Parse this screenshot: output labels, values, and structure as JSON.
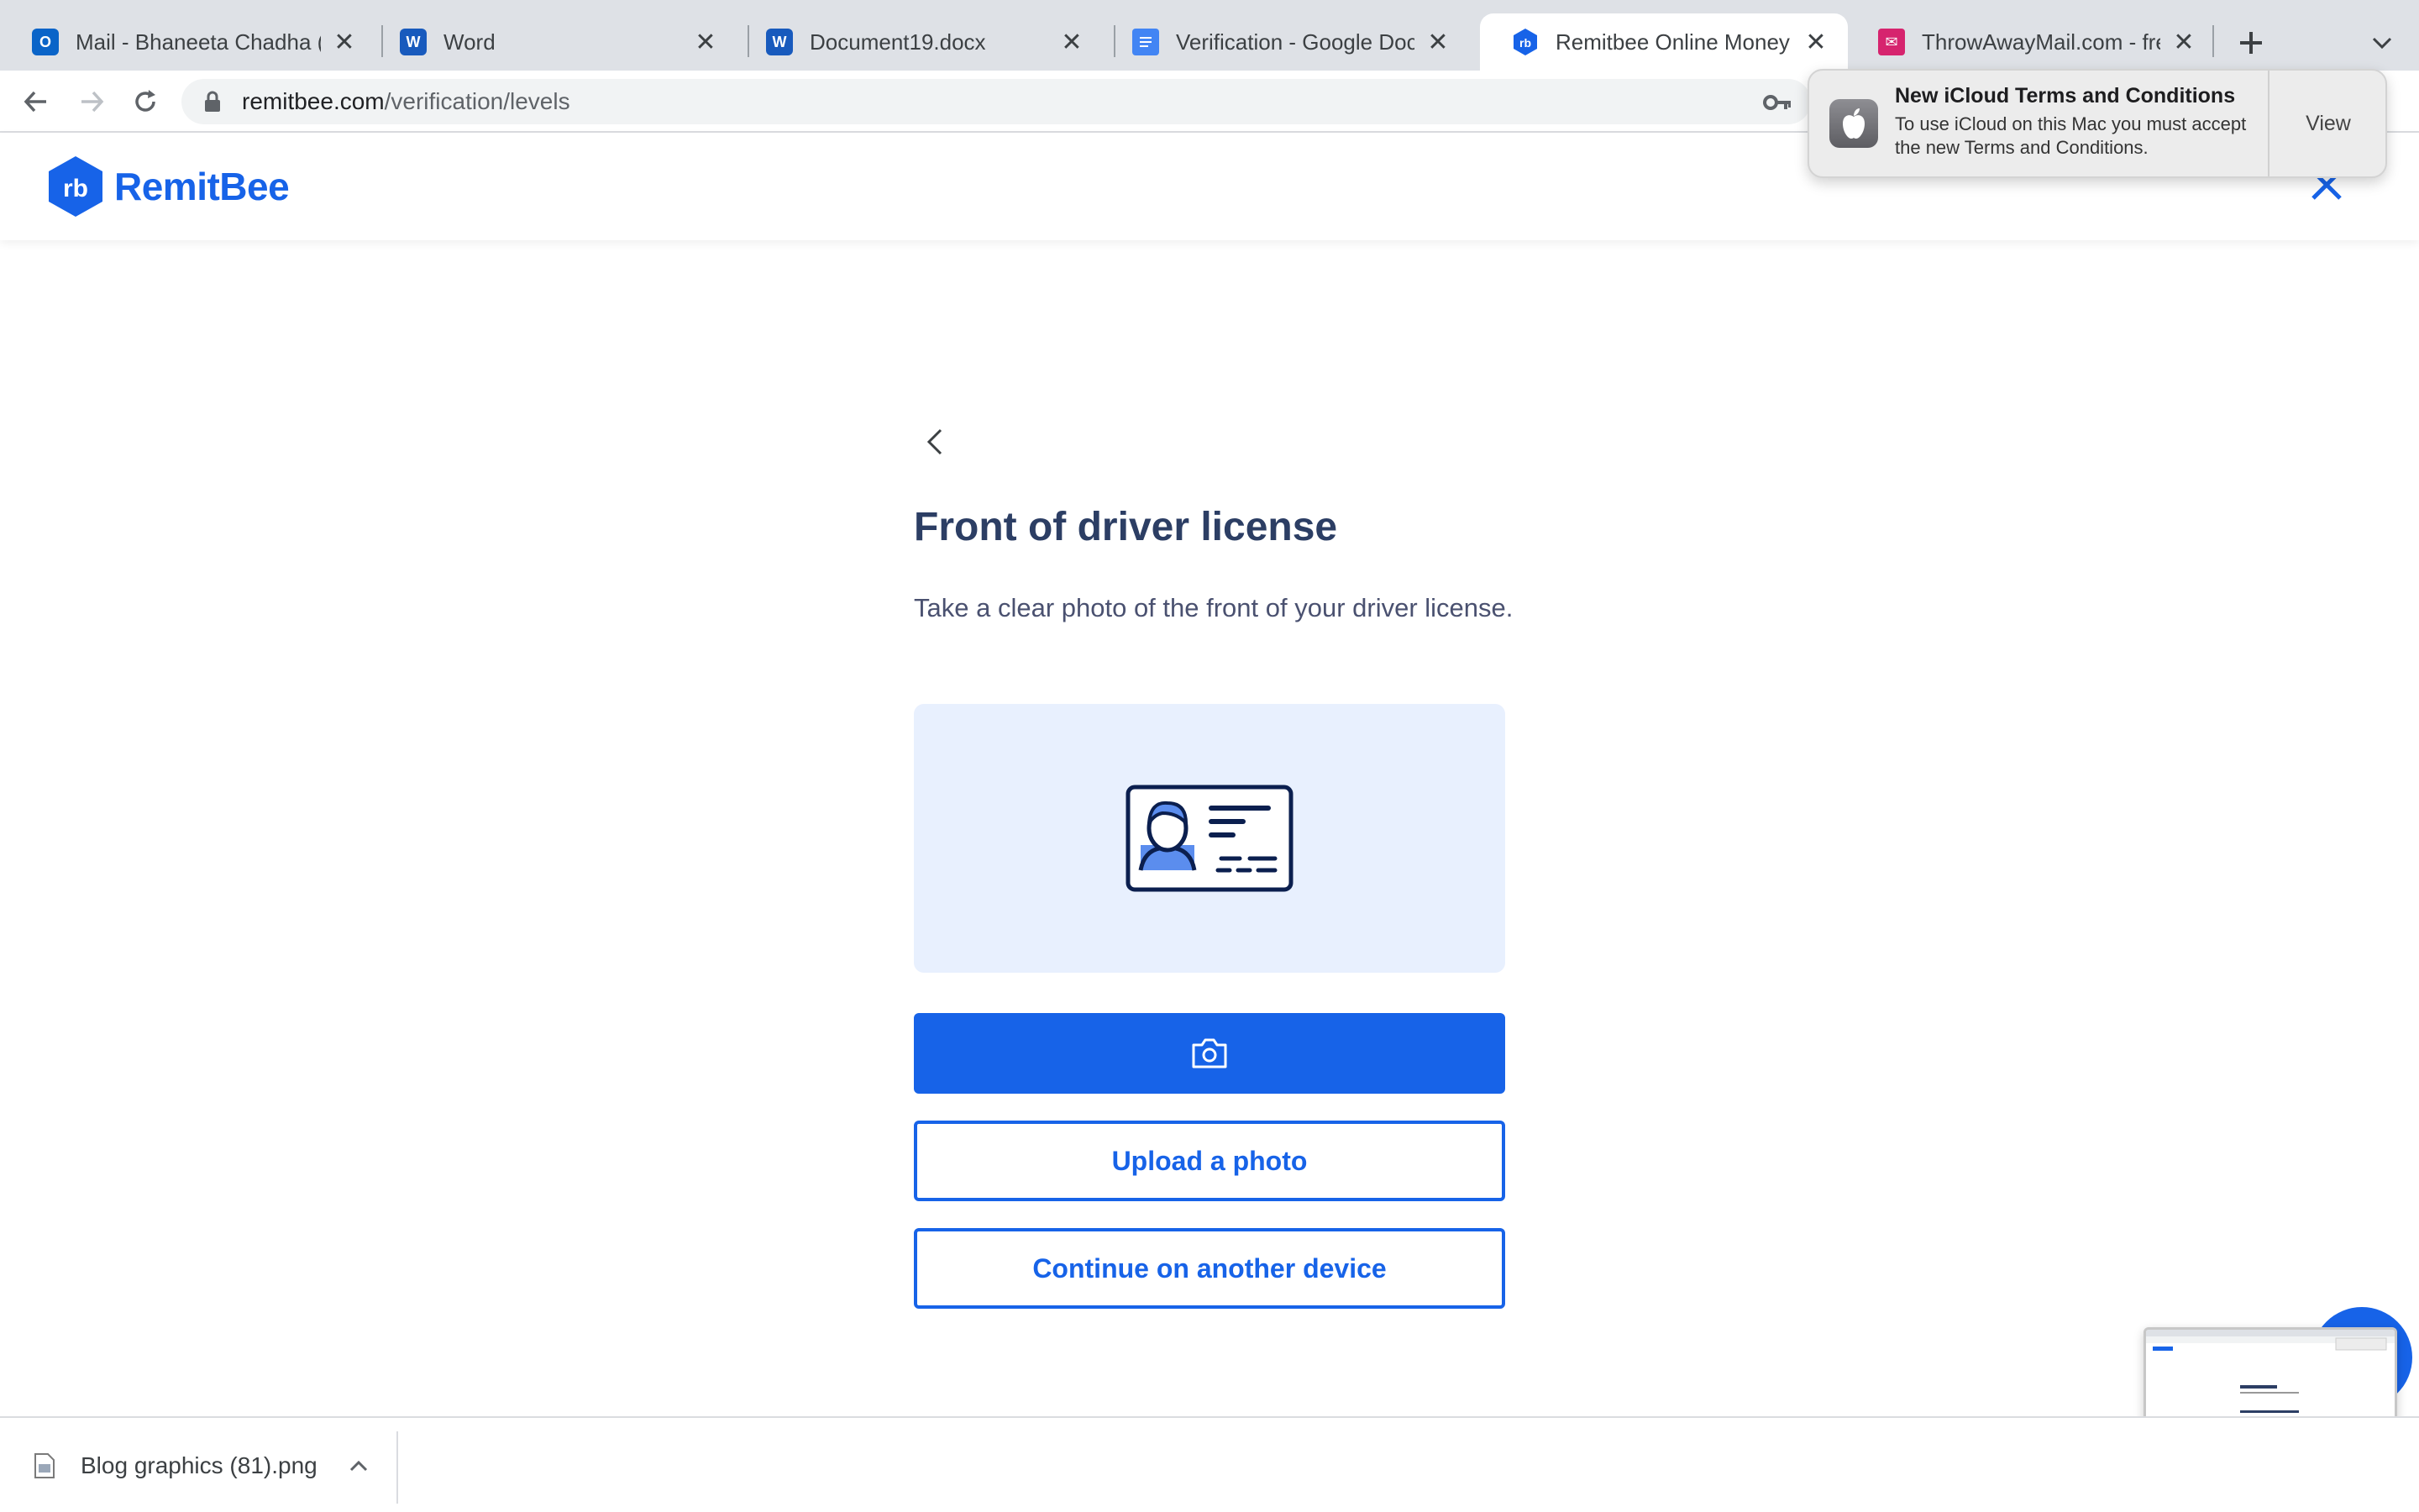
{
  "browser": {
    "tabs": [
      {
        "title": "Mail - Bhaneeta Chadha (Re",
        "favicon": "outlook-icon",
        "color": "#0a64c8"
      },
      {
        "title": "Word",
        "favicon": "word-icon",
        "color": "#185abd"
      },
      {
        "title": "Document19.docx",
        "favicon": "word-icon",
        "color": "#185abd"
      },
      {
        "title": "Verification - Google Docs",
        "favicon": "google-docs-icon",
        "color": "#4285f4"
      },
      {
        "title": "Remitbee Online Money Tra",
        "favicon": "remitbee-icon",
        "color": "#1763e8"
      },
      {
        "title": "ThrowAwayMail.com - free",
        "favicon": "throwawaymail-icon",
        "color": "#d6246e"
      }
    ],
    "active_tab": 4,
    "url_host": "remitbee.com",
    "url_path": "/verification/levels"
  },
  "site": {
    "logo_text": "RemitBee",
    "logo_mark": "rb",
    "brand_color": "#1763e8"
  },
  "page": {
    "title": "Front of driver license",
    "description": "Take a clear photo of the front of your driver license.",
    "upload_label": "Upload a photo",
    "continue_label": "Continue on another device"
  },
  "download": {
    "filename": "Blog graphics (81).png"
  },
  "notification": {
    "title": "New iCloud Terms and Conditions",
    "body": "To use iCloud on this Mac you must accept the new Terms and Conditions.",
    "action": "View"
  }
}
